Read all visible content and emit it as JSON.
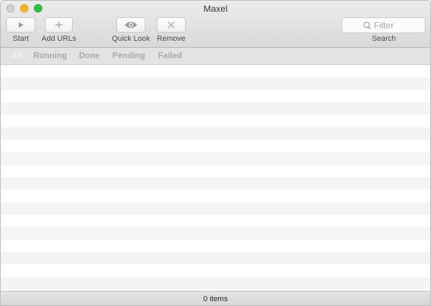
{
  "window": {
    "title": "Maxel"
  },
  "toolbar": {
    "start_label": "Start",
    "add_urls_label": "Add URLs",
    "quick_look_label": "Quick Look",
    "remove_label": "Remove",
    "search_label": "Search",
    "search_placeholder": "Filter",
    "icons": {
      "start": "play-icon",
      "add_urls": "plus-icon",
      "quick_look": "eye-icon",
      "remove": "x-icon",
      "search": "magnifier-icon"
    }
  },
  "filters": {
    "tabs": [
      {
        "label": "All",
        "active": true
      },
      {
        "label": "Running",
        "active": false
      },
      {
        "label": "Done",
        "active": false
      },
      {
        "label": "Pending",
        "active": false
      },
      {
        "label": "Failed",
        "active": false
      }
    ]
  },
  "status": {
    "item_count": "0 items"
  }
}
